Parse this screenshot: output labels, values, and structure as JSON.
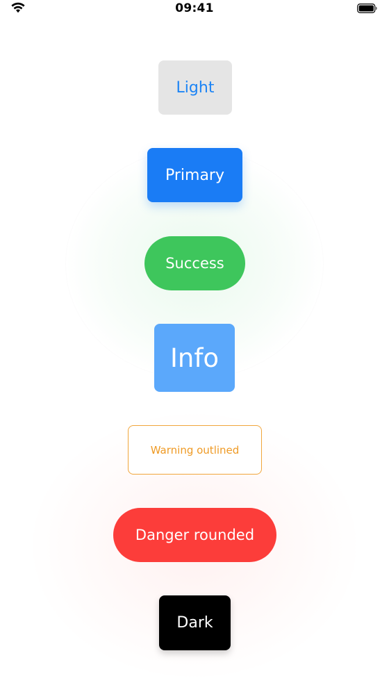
{
  "status_bar": {
    "time": "09:41",
    "wifi_icon": "wifi-icon",
    "battery_icon": "battery-full-icon"
  },
  "buttons": {
    "light": {
      "label": "Light",
      "color": "#1c84f5",
      "background": "#e5e5e5"
    },
    "primary": {
      "label": "Primary",
      "background": "#1a7cf5"
    },
    "success": {
      "label": "Success",
      "background": "#3ec65c"
    },
    "info": {
      "label": "Info",
      "background": "#5ba8fb"
    },
    "warning": {
      "label": "Warning outlined",
      "color": "#ef9a24"
    },
    "danger": {
      "label": "Danger rounded",
      "background": "#fc3d3a"
    },
    "dark": {
      "label": "Dark",
      "background": "#000000"
    }
  }
}
